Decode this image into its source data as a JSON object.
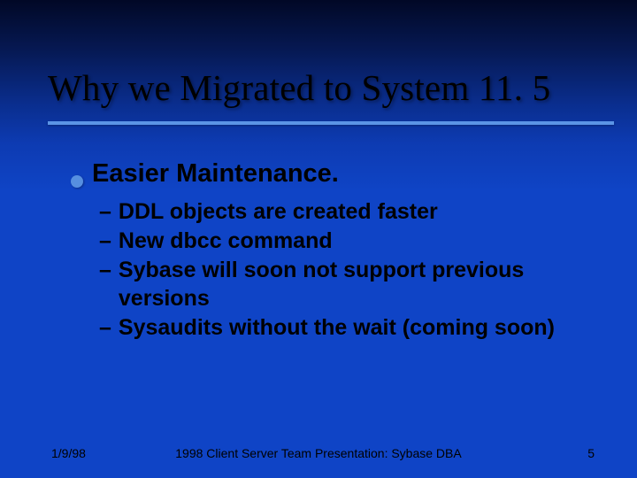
{
  "title": "Why we Migrated to System 11. 5",
  "bullet": {
    "heading": "Easier Maintenance.",
    "subitems": [
      "DDL objects are created faster",
      "New dbcc command",
      "Sybase will soon not support previous versions",
      "Sysaudits without the wait (coming soon)"
    ]
  },
  "footer": {
    "date": "1/9/98",
    "center": "1998 Client Server Team Presentation: Sybase DBA",
    "page": "5"
  },
  "colors": {
    "accent": "#568fe0",
    "rule": "#5b95e6"
  }
}
